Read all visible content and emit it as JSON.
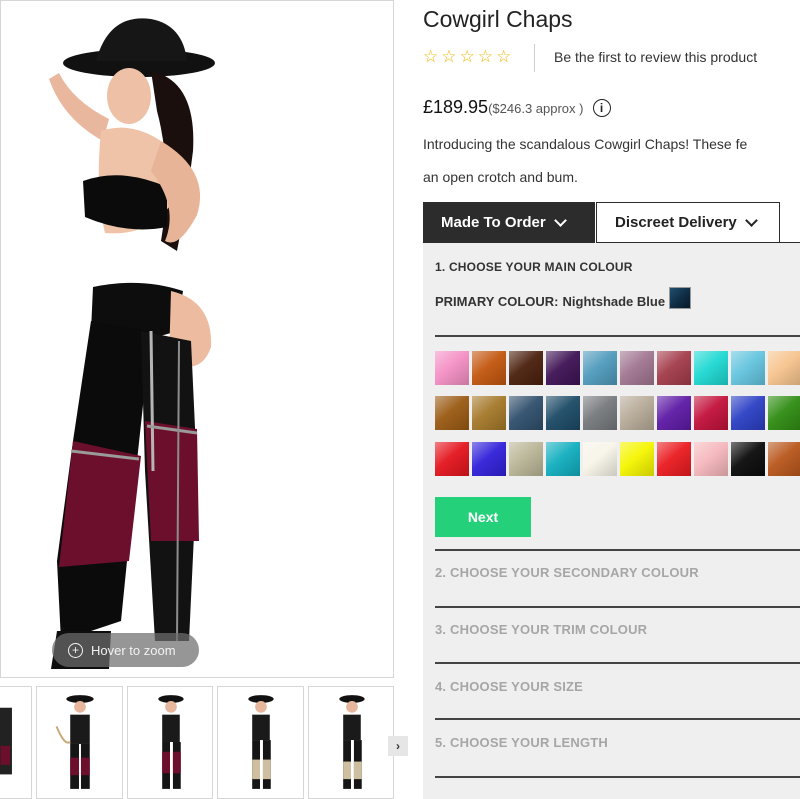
{
  "product": {
    "title": "Cowgirl Chaps",
    "review_link": "Be the first to review this product",
    "price": "£189.95",
    "price_approx": "($246.3 approx )",
    "info_icon": "i",
    "description_line1": "Introducing the scandalous Cowgirl Chaps! These fe",
    "description_line2": "an open crotch and bum."
  },
  "rating": {
    "stars": [
      "☆",
      "☆",
      "☆",
      "☆",
      "☆"
    ],
    "value": 0
  },
  "gallery": {
    "zoom_label": "Hover to zoom",
    "zoom_icon": "+",
    "next_arrow": "›",
    "thumbnail_count": 5
  },
  "tabs": {
    "made_to_order": "Made To Order",
    "discreet_delivery": "Discreet Delivery"
  },
  "configurator": {
    "step1_title": "1. CHOOSE YOUR MAIN COLOUR",
    "primary_label": "PRIMARY COLOUR:",
    "primary_value": "Nightshade Blue",
    "primary_color": "#123a56",
    "next_label": "Next",
    "step2_title": "2. CHOOSE YOUR SECONDARY COLOUR",
    "step3_title": "3. CHOOSE YOUR TRIM COLOUR",
    "step4_title": "4. CHOOSE YOUR SIZE",
    "step5_title": "5. CHOOSE YOUR LENGTH",
    "swatches_row1": [
      "#f48fc4",
      "#c2560e",
      "#4a1f0c",
      "#3e1254",
      "#4f9abc",
      "#a07590",
      "#a33b4a",
      "#1ed8d2",
      "#63c4de",
      "#f6c38d"
    ],
    "swatches_row2": [
      "#9a5a12",
      "#a47829",
      "#2f4f6c",
      "#1c4a66",
      "#76797c",
      "#b7aa98",
      "#5d1aa5",
      "#c2103a",
      "#2b3fc4",
      "#2f8c12"
    ],
    "swatches_row3": [
      "#e4141d",
      "#3020d9",
      "#b9b596",
      "#11aebf",
      "#f7f4e8",
      "#f5f500",
      "#ea1b20",
      "#f5b7bc",
      "#0a0a0a",
      "#b8561b"
    ]
  },
  "colors": {
    "accent_green": "#25d07a",
    "tab_dark": "#2c2c2c",
    "panel_bg": "#efefef",
    "star": "#f0b400"
  }
}
